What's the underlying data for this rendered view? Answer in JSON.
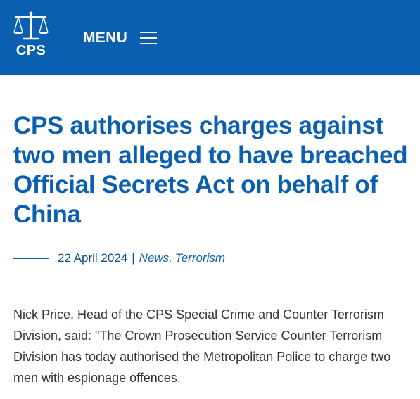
{
  "header": {
    "logo_text": "CPS",
    "menu_label": "MENU",
    "logo_icon": "scales-of-justice-icon",
    "menu_icon": "hamburger-menu-icon",
    "background_color": "#0a5fb0"
  },
  "article": {
    "title": "CPS authorises charges against two men alleged to have breached Official Secrets Act on behalf of China",
    "date": "22 April 2024",
    "separator": "|",
    "categories": [
      {
        "label": "News",
        "suffix": ","
      },
      {
        "label": "Terrorism",
        "suffix": ""
      }
    ],
    "category_1": "News,",
    "category_2": "Terrorism",
    "body": "Nick Price, Head of the CPS Special Crime and Counter Terrorism Division, said: \"The Crown Prosecution Service Counter Terrorism Division has today authorised the Metropolitan Police to charge two men with espionage offences."
  }
}
